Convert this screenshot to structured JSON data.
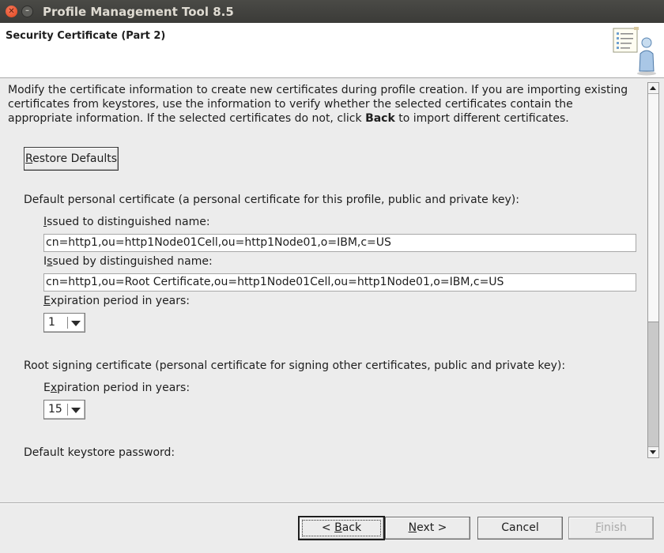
{
  "window": {
    "title": "Profile Management Tool 8.5"
  },
  "header": {
    "title": "Security Certificate (Part 2)",
    "icon": "wizard-clipboard-person-icon"
  },
  "content": {
    "description_part1": "Modify the certificate information to create new certificates during profile creation. If you are importing existing certificates from keystores, use the information to verify whether the selected certificates contain the appropriate information. If the selected certificates do not, click ",
    "description_bold": "Back",
    "description_part2": " to import different certificates.",
    "restore_defaults_label_first": "R",
    "restore_defaults_label_rest": "estore Defaults",
    "personal_cert_heading": "Default personal certificate (a personal certificate for this profile, public and private key):",
    "issued_to_label_first": "I",
    "issued_to_label_rest": "ssued to distinguished name:",
    "issued_to_value": "cn=http1,ou=http1Node01Cell,ou=http1Node01,o=IBM,c=US",
    "issued_by_label_first": "I",
    "issued_by_label_mid": "s",
    "issued_by_label_rest": "sued by distinguished name:",
    "issued_by_value": "cn=http1,ou=Root Certificate,ou=http1Node01Cell,ou=http1Node01,o=IBM,c=US",
    "personal_expiration_label_first": "E",
    "personal_expiration_label_rest": "xpiration period in years:",
    "personal_expiration_value": "1",
    "root_cert_heading": "Root signing certificate (personal certificate for signing other certificates, public and private key):",
    "root_expiration_label_first": "E",
    "root_expiration_label_mid": "x",
    "root_expiration_label_rest": "piration period in years:",
    "root_expiration_value": "15",
    "keystore_password_label": "Default keystore password:"
  },
  "footer": {
    "back_prefix": "< ",
    "back_first": "B",
    "back_rest": "ack",
    "next_first": "N",
    "next_rest": "ext >",
    "cancel": "Cancel",
    "finish_first": "F",
    "finish_rest": "inish"
  }
}
